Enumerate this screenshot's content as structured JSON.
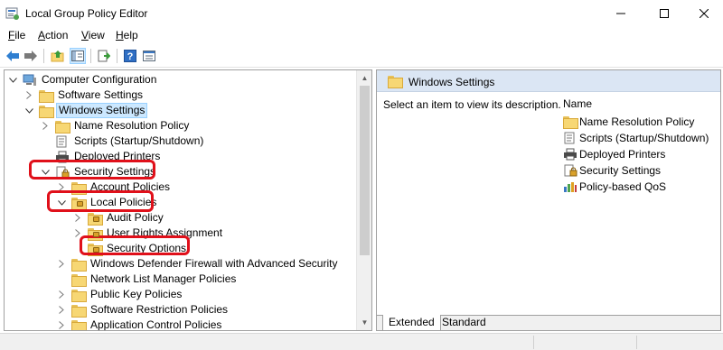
{
  "window": {
    "title": "Local Group Policy Editor",
    "app_icon": "group-policy-icon",
    "controls": [
      "minimize-icon",
      "maximize-icon",
      "close-icon"
    ]
  },
  "menu": {
    "items": [
      {
        "label_ul": "F",
        "label_rest": "ile"
      },
      {
        "label_ul": "A",
        "label_rest": "ction"
      },
      {
        "label_ul": "V",
        "label_rest": "iew"
      },
      {
        "label_ul": "H",
        "label_rest": "elp"
      }
    ]
  },
  "toolbar": {
    "buttons": [
      "back-arrow-icon",
      "forward-arrow-icon",
      "up-folder-icon",
      "show-hide-tree-icon",
      "export-list-icon",
      "help-icon",
      "properties-view-icon"
    ]
  },
  "tree": {
    "items": [
      {
        "label": "Computer Configuration",
        "icon": "computer-icon"
      },
      {
        "label": "Software Settings",
        "icon": "folder-icon"
      },
      {
        "label": "Windows Settings",
        "icon": "folder-icon"
      },
      {
        "label": "Name Resolution Policy",
        "icon": "folder-icon"
      },
      {
        "label": "Scripts (Startup/Shutdown)",
        "icon": "scripts-icon"
      },
      {
        "label": "Deployed Printers",
        "icon": "printer-icon"
      },
      {
        "label": "Security Settings",
        "icon": "security-settings-icon"
      },
      {
        "label": "Account Policies",
        "icon": "folder-icon"
      },
      {
        "label": "Local Policies",
        "icon": "locked-folder-icon"
      },
      {
        "label": "Audit Policy",
        "icon": "locked-folder-icon"
      },
      {
        "label": "User Rights Assignment",
        "icon": "locked-folder-icon"
      },
      {
        "label": "Security Options",
        "icon": "locked-folder-icon"
      },
      {
        "label": "Windows Defender Firewall with Advanced Security",
        "icon": "folder-icon"
      },
      {
        "label": "Network List Manager Policies",
        "icon": "folder-icon"
      },
      {
        "label": "Public Key Policies",
        "icon": "folder-icon"
      },
      {
        "label": "Software Restriction Policies",
        "icon": "folder-icon"
      },
      {
        "label": "Application Control Policies",
        "icon": "folder-icon"
      }
    ]
  },
  "right": {
    "header_title": "Windows Settings",
    "description": "Select an item to view its description.",
    "column_name": "Name",
    "items": [
      {
        "label": "Name Resolution Policy",
        "icon": "folder-icon"
      },
      {
        "label": "Scripts (Startup/Shutdown)",
        "icon": "scripts-icon"
      },
      {
        "label": "Deployed Printers",
        "icon": "printer-icon"
      },
      {
        "label": "Security Settings",
        "icon": "security-settings-icon"
      },
      {
        "label": "Policy-based QoS",
        "icon": "bar-chart-icon"
      }
    ],
    "tabs": [
      "Extended",
      "Standard"
    ],
    "active_tab": "Extended"
  },
  "colors": {
    "annotation_red": "#e0101a",
    "selection_blue": "#cce8ff",
    "pane_header_blue": "#dbe6f4",
    "folder_yellow": "#f7d774"
  }
}
